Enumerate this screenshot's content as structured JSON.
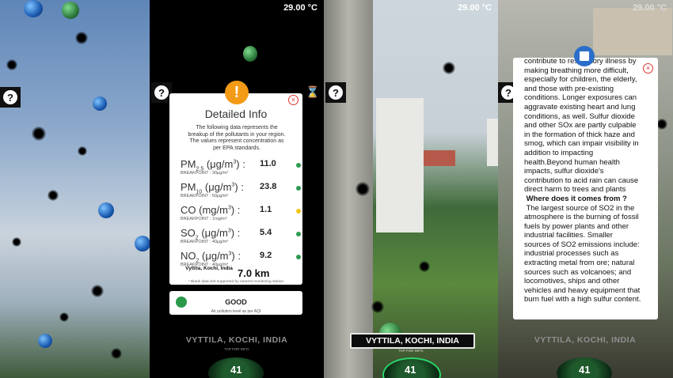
{
  "panel1": {
    "help_glyph": "?"
  },
  "panel2": {
    "temperature": "29.00 °C",
    "help_glyph": "?",
    "card": {
      "title": "Detailed Info",
      "close_glyph": "×",
      "warn_glyph": "!",
      "description": "The following data represents the breakup of the pollutants in your region. The values represent concentration as per EPA standards.",
      "pollutants": [
        {
          "name": "PM",
          "sub": "2.5",
          "unit_pre": " (μg/m",
          "sup": "3",
          "unit_post": ") :",
          "value": "11.0",
          "breakpoint": "BREAKPOINT : 30μg/m³",
          "color": "#2e9a52"
        },
        {
          "name": "PM",
          "sub": "10",
          "unit_pre": " (μg/m",
          "sup": "3",
          "unit_post": ") :",
          "value": "23.8",
          "breakpoint": "BREAKPOINT : 50μg/m³",
          "color": "#2e9a52"
        },
        {
          "name": "CO",
          "sub": "",
          "unit_pre": " (mg/m",
          "sup": "3",
          "unit_post": ") :",
          "value": "1.1",
          "breakpoint": "BREAKPOINT : 1mg/m³",
          "color": "#f0c419"
        },
        {
          "name": "SO",
          "sub": "2",
          "unit_pre": " (μg/m",
          "sup": "3",
          "unit_post": ") :",
          "value": "5.4",
          "breakpoint": "BREAKPOINT : 40μg/m³",
          "color": "#2e9a52"
        },
        {
          "name": "NO",
          "sub": "2",
          "unit_pre": " (μg/m",
          "sup": "3",
          "unit_post": ") :",
          "value": "9.2",
          "breakpoint": "BREAKPOINT : 40μg/m³",
          "color": "#2e9a52"
        }
      ],
      "station_name": "Vyttila, Kochi, India",
      "distance": "7.0 km",
      "footnote": "* Blank data isnt supported by nearest monitoring station"
    },
    "aqi_card": {
      "status": "GOOD",
      "subtitle": "Air pollution level as per AQI"
    },
    "location": "VYTTILA, KOCHI, INDIA",
    "tap_info": "TAP FOR INFO",
    "aqi_value": "41"
  },
  "panel3": {
    "temperature": "29.00 °C",
    "help_glyph": "?",
    "location": "VYTTILA, KOCHI, INDIA",
    "tap_info": "TAP FOR INFO",
    "aqi_value": "41"
  },
  "panel4": {
    "temperature": "29.00 °C",
    "help_glyph": "?",
    "close_glyph": "×",
    "text_lines": [
      "contribute to respiratory illness by",
      "making breathing more difficult,",
      "especially for children, the elderly,",
      "and those with pre-existing",
      "conditions. Longer exposures can",
      "aggravate existing heart and lung",
      "conditions, as well. Sulfur dioxide",
      "and other SOx are partly culpable",
      "in the formation of thick haze and",
      "smog, which can impair visibility in",
      "addition to impacting",
      "health.Beyond human health",
      "impacts, sulfur dioxide's",
      "contribution to acid rain can cause",
      "direct harm to trees and plants",
      " Where does it comes from ?",
      " The largest source of SO2 in the",
      "atmosphere is the burning of fossil",
      "fuels by power plants and other",
      "industrial facilities. Smaller",
      "sources of SO2 emissions include:",
      "industrial processes such as",
      "extracting metal from ore; natural",
      "sources such as volcanoes; and",
      "locomotives, ships and other",
      "vehicles and heavy equipment that",
      "burn fuel with a high sulfur content."
    ],
    "heading_index": 15,
    "location": "VYTTILA, KOCHI, INDIA",
    "aqi_value": "41"
  }
}
